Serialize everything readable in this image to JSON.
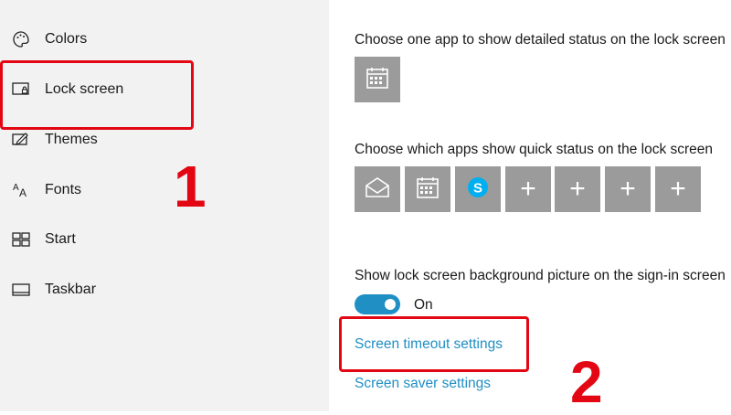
{
  "sidebar": {
    "items": [
      {
        "label": "Colors",
        "icon": "palette-icon"
      },
      {
        "label": "Lock screen",
        "icon": "lock-screen-icon"
      },
      {
        "label": "Themes",
        "icon": "themes-icon"
      },
      {
        "label": "Fonts",
        "icon": "fonts-icon"
      },
      {
        "label": "Start",
        "icon": "start-icon"
      },
      {
        "label": "Taskbar",
        "icon": "taskbar-icon"
      }
    ]
  },
  "main": {
    "detailed_status_heading": "Choose one app to show detailed status on the lock screen",
    "detailed_status_app": "calendar-icon",
    "quick_status_heading": "Choose which apps show quick status on the lock screen",
    "quick_status_apps": [
      "mail-icon",
      "calendar-icon",
      "skype-icon",
      "add-icon",
      "add-icon",
      "add-icon",
      "add-icon"
    ],
    "plus_glyph": "+",
    "skype_letter": "S",
    "background_heading": "Show lock screen background picture on the sign-in screen",
    "toggle_state": "On",
    "toggle_on": true,
    "links": {
      "screen_timeout": "Screen timeout settings",
      "screen_saver": "Screen saver settings"
    }
  },
  "annotations": {
    "marker_1": "1",
    "marker_2": "2",
    "color": "#e30613"
  },
  "colors": {
    "accent": "#1f8fc4",
    "tile": "#9b9b9b",
    "sidebar_bg": "#f2f2f2"
  }
}
